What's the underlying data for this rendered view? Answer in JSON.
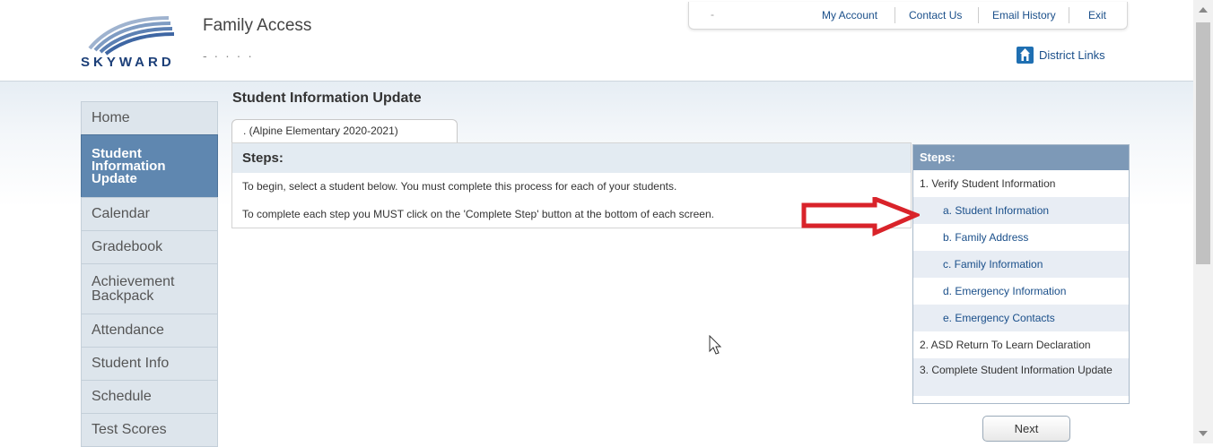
{
  "header": {
    "brand": "SKYWARD",
    "app_title": "Family Access",
    "student_name": "- ·  ·  ·   ·",
    "toolbar": {
      "selector": "-",
      "my_account": "My Account",
      "contact_us": "Contact Us",
      "email_history": "Email History",
      "exit": "Exit"
    },
    "district_links": "District Links"
  },
  "sidebar": {
    "items": [
      {
        "label": "Home"
      },
      {
        "label": "Student Information Update",
        "active": true
      },
      {
        "label": "Calendar"
      },
      {
        "label": "Gradebook"
      },
      {
        "label": "Achievement Backpack"
      },
      {
        "label": "Attendance"
      },
      {
        "label": "Student Info"
      },
      {
        "label": "Schedule"
      },
      {
        "label": "Test Scores"
      }
    ]
  },
  "main": {
    "page_title": "Student Information Update",
    "tab_label": ".   (Alpine Elementary 2020-2021)",
    "panel": {
      "heading": "Steps:",
      "line1": "To begin, select a student below. You must complete this process for each of your students.",
      "line2": "To complete each step you MUST click on the 'Complete Step' button at the bottom of each screen."
    }
  },
  "steps": {
    "heading": "Steps:",
    "items": [
      {
        "label": "1. Verify Student Information"
      },
      {
        "label": "a. Student Information"
      },
      {
        "label": "b. Family Address"
      },
      {
        "label": "c. Family Information"
      },
      {
        "label": "d. Emergency Information"
      },
      {
        "label": "e. Emergency Contacts"
      },
      {
        "label": "2. ASD Return To Learn Declaration"
      },
      {
        "label": "3. Complete Student Information Update"
      }
    ],
    "next_label": "Next"
  },
  "colors": {
    "accent": "#5f87b0",
    "link": "#1a4f8a",
    "annotation_arrow": "#d9232a"
  },
  "icons": [
    "skyward-logo",
    "district-building-icon",
    "red-arrow-annotation",
    "mouse-pointer-icon"
  ]
}
